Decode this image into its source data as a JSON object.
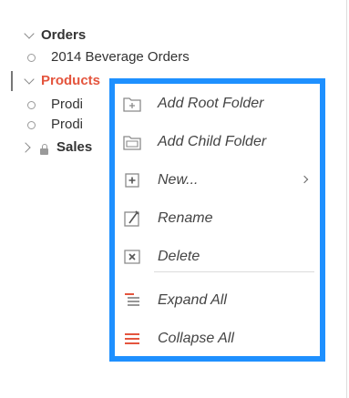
{
  "tree": {
    "items": [
      {
        "label": "Orders"
      },
      {
        "label": "2014 Beverage Orders"
      },
      {
        "label": "Products"
      },
      {
        "label": "Prodi"
      },
      {
        "label": "Prodi"
      },
      {
        "label": "Sales"
      }
    ]
  },
  "context_menu": {
    "items": [
      {
        "label": "Add Root Folder",
        "icon": "add-root-folder-icon"
      },
      {
        "label": "Add Child Folder",
        "icon": "add-child-folder-icon"
      },
      {
        "label": "New...",
        "icon": "new-icon",
        "submenu": true
      },
      {
        "label": "Rename",
        "icon": "rename-icon"
      },
      {
        "label": "Delete",
        "icon": "delete-icon"
      },
      {
        "label": "Expand All",
        "icon": "expand-all-icon"
      },
      {
        "label": "Collapse All",
        "icon": "collapse-all-icon"
      }
    ]
  },
  "colors": {
    "accent": "#e4553e",
    "menu_border": "#1e90ff",
    "text": "#333333",
    "icon": "#888888"
  }
}
